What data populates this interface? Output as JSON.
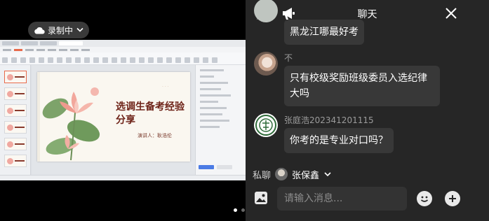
{
  "recording": {
    "label": "录制中",
    "icon": "cloud-icon"
  },
  "presentation": {
    "slide_title": "选调生备考经验分享",
    "speaker_line": "演讲人：耿浩伦",
    "slide_count": 6,
    "current_slide": 1,
    "accent_color": "#e86a4b"
  },
  "screen_pager": {
    "pages": 2,
    "current": 1
  },
  "chat": {
    "title": "聊天",
    "icons": {
      "left": "chat-bubbles-icon",
      "announce": "megaphone-icon",
      "close": "close-icon"
    },
    "messages": [
      {
        "sender": "",
        "text": "黑龙江哪最好考"
      },
      {
        "sender": "不",
        "text": "只有校级奖励班级委员入选纪律大吗"
      },
      {
        "sender": "张庭浩202341201115",
        "text": "你考的是专业对口吗？"
      }
    ],
    "private": {
      "label": "私聊",
      "target": "张保鑫"
    },
    "input": {
      "placeholder": "请输入消息..."
    },
    "buttons": {
      "image": "image-icon",
      "emoji": "emoji-icon",
      "more": "plus-icon"
    }
  }
}
